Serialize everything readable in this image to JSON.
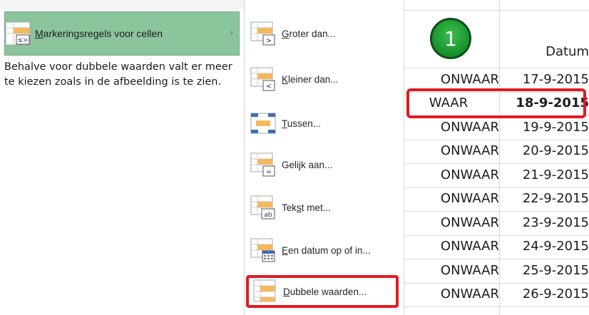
{
  "left_menu": {
    "item_label_prefix": "M",
    "item_label_rest": "arkeringsregels voor cellen",
    "item_arrow": "›",
    "description": "Behalve voor dubbele waarden valt er meer te kiezen zoals in de afbeelding is te zien."
  },
  "submenu": {
    "items": [
      {
        "accel": "G",
        "rest": "roter dan...",
        "icon": "greater-than-icon"
      },
      {
        "accel": "K",
        "rest": "leiner dan...",
        "icon": "less-than-icon"
      },
      {
        "accel": "T",
        "rest": "ussen...",
        "icon": "between-icon"
      },
      {
        "accel": "",
        "rest": "Gelijk aan...",
        "icon": "equal-to-icon"
      },
      {
        "pre": "Tek",
        "accel": "s",
        "rest": "t met...",
        "icon": "text-contains-icon"
      },
      {
        "accel": "E",
        "rest": "en datum op of in...",
        "icon": "date-occurring-icon"
      },
      {
        "accel": "D",
        "rest": "ubbele waarden...",
        "icon": "duplicate-values-icon"
      }
    ]
  },
  "sheet": {
    "badge": "1",
    "header_b": "Datum",
    "rows": [
      {
        "a": "ONWAAR",
        "b": "17-9-2015"
      },
      {
        "a": "WAAR",
        "b": "18-9-2015"
      },
      {
        "a": "ONWAAR",
        "b": "19-9-2015"
      },
      {
        "a": "ONWAAR",
        "b": "20-9-2015"
      },
      {
        "a": "ONWAAR",
        "b": "21-9-2015"
      },
      {
        "a": "ONWAAR",
        "b": "22-9-2015"
      },
      {
        "a": "ONWAAR",
        "b": "23-9-2015"
      },
      {
        "a": "ONWAAR",
        "b": "24-9-2015"
      },
      {
        "a": "ONWAAR",
        "b": "25-9-2015"
      },
      {
        "a": "ONWAAR",
        "b": "26-9-2015"
      }
    ]
  },
  "colors": {
    "menu_highlight": "#8cc49c",
    "outline_red": "#e01a22",
    "badge_green": "#16912a"
  }
}
